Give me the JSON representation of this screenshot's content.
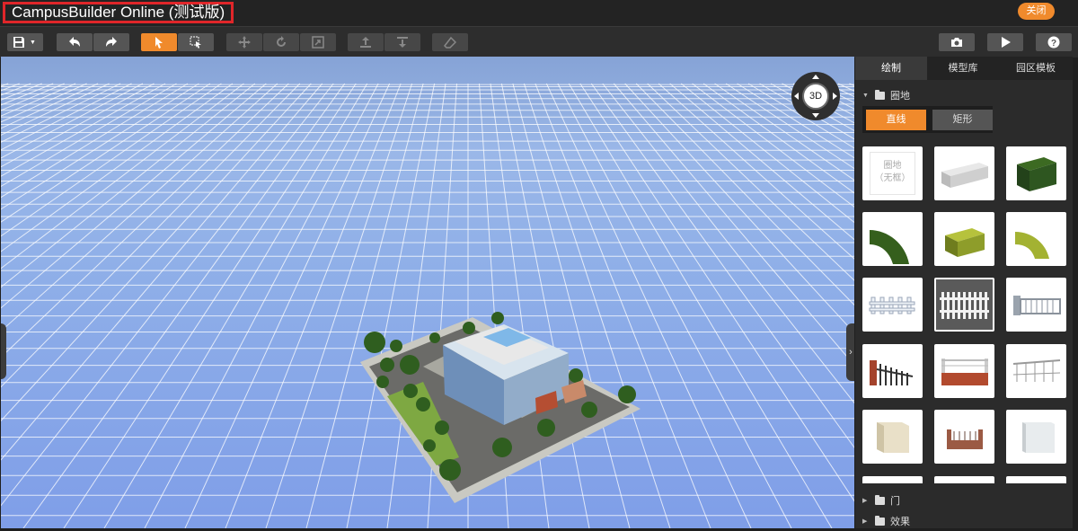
{
  "app": {
    "title": "CampusBuilder Online (测试版)",
    "close_label": "关闭"
  },
  "toolbar": {
    "buttons": [
      {
        "name": "save-button",
        "icon": "save-icon",
        "state": "normal"
      },
      {
        "name": "undo-button",
        "icon": "undo-icon",
        "state": "normal"
      },
      {
        "name": "redo-button",
        "icon": "redo-icon",
        "state": "normal"
      },
      {
        "name": "select-tool-button",
        "icon": "pointer-icon",
        "state": "active"
      },
      {
        "name": "box-select-button",
        "icon": "box-select-icon",
        "state": "normal"
      },
      {
        "name": "move-tool-button",
        "icon": "move-icon",
        "state": "disabled"
      },
      {
        "name": "rotate-tool-button",
        "icon": "rotate-icon",
        "state": "disabled"
      },
      {
        "name": "scale-tool-button",
        "icon": "scale-icon",
        "state": "disabled"
      },
      {
        "name": "raise-button",
        "icon": "raise-icon",
        "state": "disabled"
      },
      {
        "name": "lower-button",
        "icon": "lower-icon",
        "state": "disabled"
      },
      {
        "name": "eraser-button",
        "icon": "eraser-icon",
        "state": "disabled"
      },
      {
        "name": "screenshot-button",
        "icon": "camera-icon",
        "state": "normal"
      },
      {
        "name": "play-button",
        "icon": "play-icon",
        "state": "normal"
      },
      {
        "name": "help-button",
        "icon": "help-icon",
        "state": "normal"
      }
    ]
  },
  "viewport": {
    "nav_label": "3D"
  },
  "panel": {
    "tabs": [
      {
        "label": "绘制",
        "active": true
      },
      {
        "label": "模型库",
        "active": false
      },
      {
        "label": "园区模板",
        "active": false
      }
    ],
    "section_enclosure": "圈地",
    "modes": [
      {
        "label": "直线",
        "active": true
      },
      {
        "label": "矩形",
        "active": false
      }
    ],
    "tile_borderless_label": "圈地\n（无框）",
    "section_door": "门",
    "section_effect": "效果"
  },
  "colors": {
    "accent": "#f08a2c",
    "title_box": "#e0262a",
    "panel_bg": "#2b2b2b"
  }
}
